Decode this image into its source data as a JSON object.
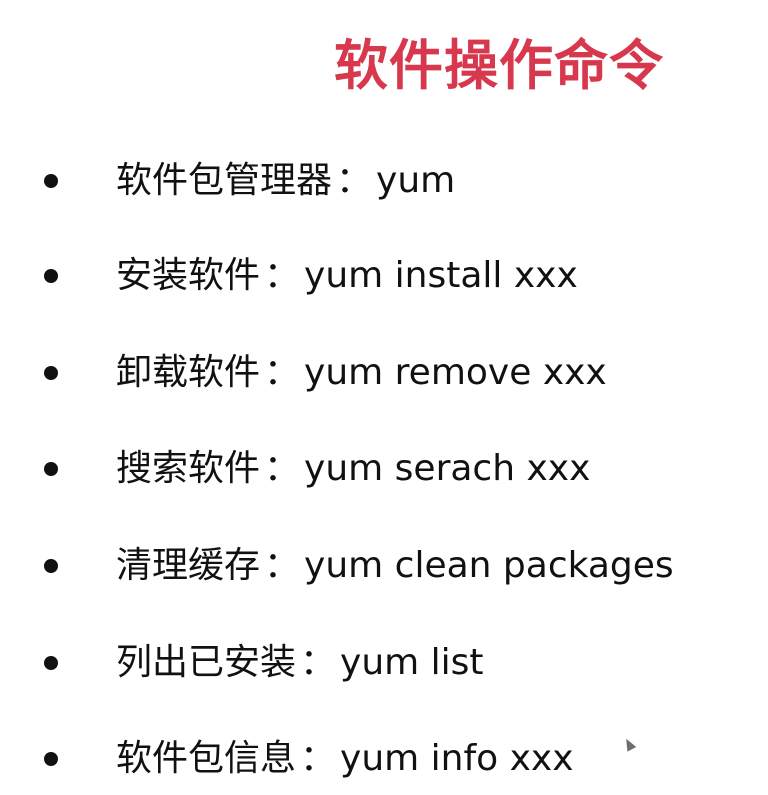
{
  "title": "软件操作命令",
  "items": [
    {
      "label": "软件包管理器",
      "separator": "：",
      "command": "yum"
    },
    {
      "label": "安装软件",
      "separator": "：",
      "command": "yum install  xxx"
    },
    {
      "label": "卸载软件",
      "separator": "：",
      "command": "yum remove xxx"
    },
    {
      "label": "搜索软件",
      "separator": "：",
      "command": "yum serach xxx"
    },
    {
      "label": "清理缓存",
      "separator": "：",
      "command": "yum clean packages"
    },
    {
      "label": "列出已安装",
      "separator": "：",
      "command": "yum list"
    },
    {
      "label": "软件包信息",
      "separator": " ： ",
      "command": "yum info xxx"
    }
  ],
  "icons": {
    "bullet": "bullet-dot-icon",
    "cursor": "mouse-pointer-icon"
  },
  "colors": {
    "title": "#d7384e",
    "text": "#111111",
    "background": "#ffffff"
  }
}
